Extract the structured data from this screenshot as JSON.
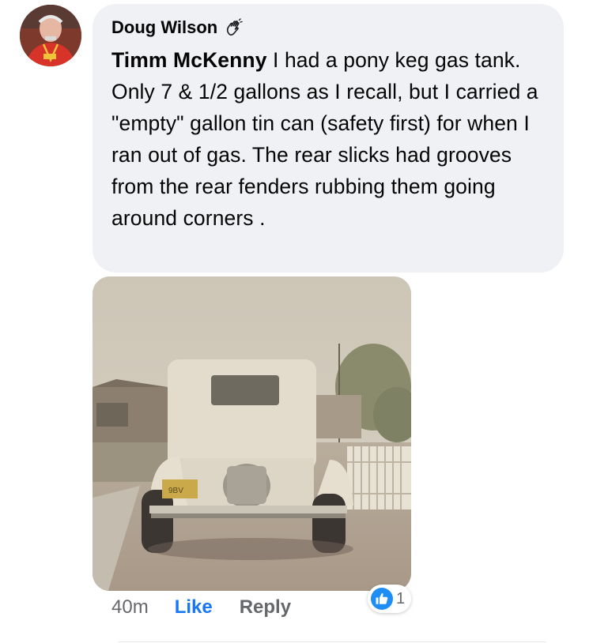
{
  "comment": {
    "author": "Doug Wilson",
    "mention": "Timm McKenny",
    "text": " I had a pony keg gas tank. Only 7 & 1/2 gallons as I recall, but I carried a \"empty\" gallon tin can (safety first) for when I ran out of gas. The rear slicks had grooves from the rear fenders rubbing them going around corners ."
  },
  "actions": {
    "time": "40m",
    "like_label": "Like",
    "reply_label": "Reply"
  },
  "reactions": {
    "count": "1",
    "icon": "thumbs-up-icon",
    "color": "#1f8df6"
  },
  "icons": {
    "author_badge": "wave-hand-icon"
  },
  "colors": {
    "bubble": "#f0f1f4",
    "link": "#1877f2",
    "meta": "#65676b"
  }
}
